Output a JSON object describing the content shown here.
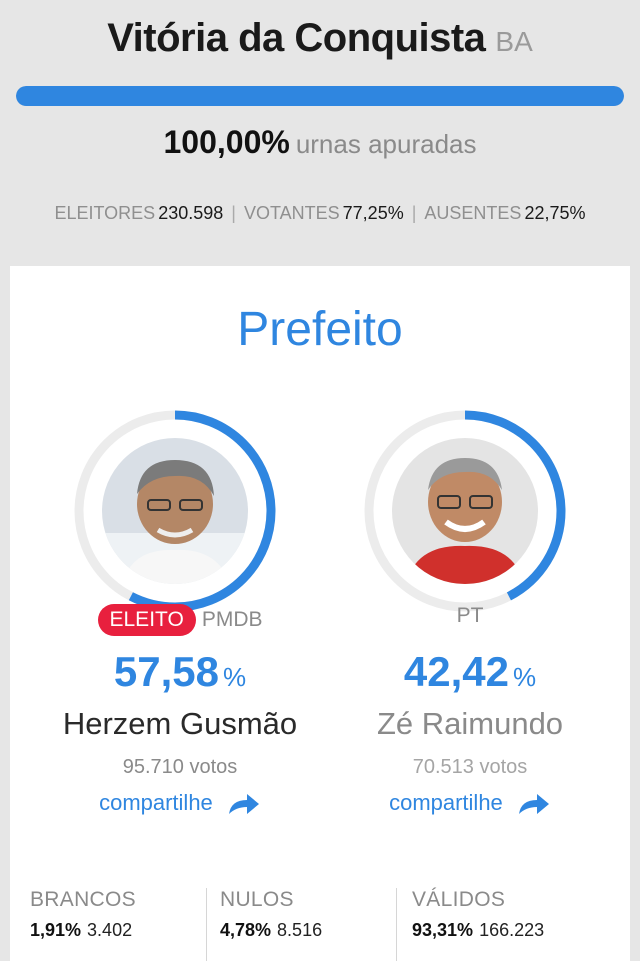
{
  "header": {
    "city": "Vitória da Conquista",
    "state": "BA",
    "progress_fraction": 1.0,
    "count_value": "100,00%",
    "count_label": "urnas apuradas",
    "stats": [
      {
        "label": "ELEITORES",
        "value": "230.598"
      },
      {
        "label": "VOTANTES",
        "value": "77,25%"
      },
      {
        "label": "AUSENTES",
        "value": "22,75%"
      }
    ]
  },
  "race": {
    "office": "Prefeito",
    "candidates": [
      {
        "name": "Herzem Gusmão",
        "party": "PMDB",
        "status": "ELEITO",
        "percent": "57,58",
        "percent_sign": "%",
        "vote_share": 0.5758,
        "votes": "95.710 votos",
        "share_label": "compartilhe"
      },
      {
        "name": "Zé Raimundo",
        "party": "PT",
        "status": "",
        "percent": "42,42",
        "percent_sign": "%",
        "vote_share": 0.4242,
        "votes": "70.513 votos",
        "share_label": "compartilhe"
      }
    ]
  },
  "totals": [
    {
      "label": "BRANCOS",
      "percent": "1,91%",
      "count": "3.402"
    },
    {
      "label": "NULOS",
      "percent": "4,78%",
      "count": "8.516"
    },
    {
      "label": "VÁLIDOS",
      "percent": "93,31%",
      "count": "166.223"
    }
  ],
  "colors": {
    "accent": "#2f86e0",
    "elected": "#e8203e",
    "ring_track": "#ececec",
    "muted": "#8a8a8a"
  }
}
